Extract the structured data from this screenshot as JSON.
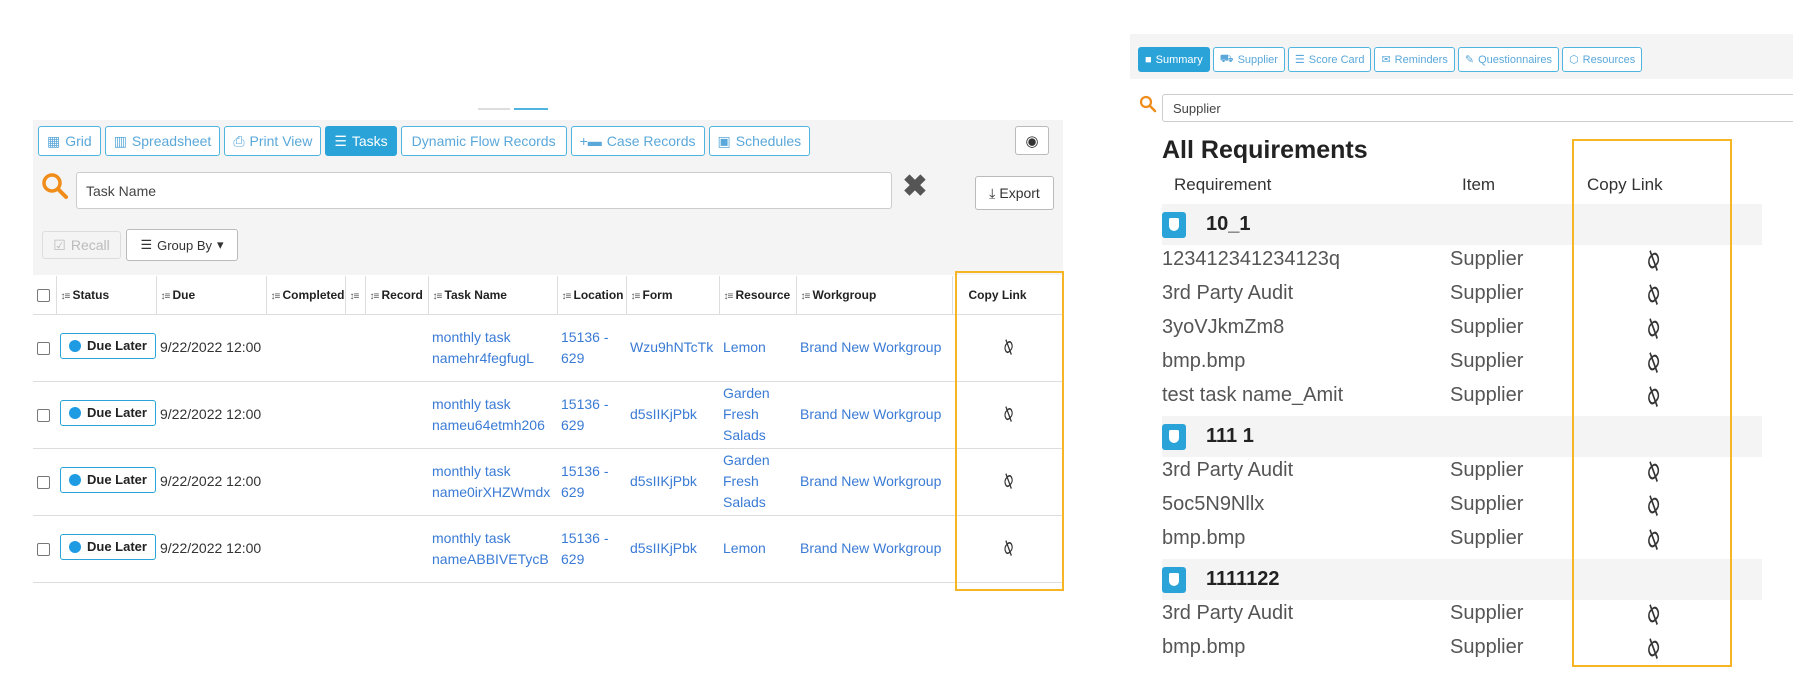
{
  "left": {
    "tabs": [
      {
        "icon": "grid-icon",
        "label": "Grid"
      },
      {
        "icon": "spreadsheet-icon",
        "label": "Spreadsheet"
      },
      {
        "icon": "print-icon",
        "label": "Print View"
      },
      {
        "icon": "tasks-icon",
        "label": "Tasks",
        "active": true
      },
      {
        "icon": "",
        "label": "Dynamic Flow Records"
      },
      {
        "icon": "briefcase-plus-icon",
        "label": "Case Records"
      },
      {
        "icon": "calendar-icon",
        "label": "Schedules"
      }
    ],
    "search": {
      "value": "Task Name"
    },
    "export_label": "Export",
    "recall_label": "Recall",
    "groupby_label": "Group By",
    "columns": [
      "Status",
      "Due",
      "Completed",
      "",
      "Record",
      "Task Name",
      "Location",
      "Form",
      "Resource",
      "Workgroup",
      "Copy Link"
    ],
    "rows": [
      {
        "status": "Due Later",
        "due": "9/22/2022 12:00",
        "task_name": "monthly task namehr4fegfugL",
        "location": "15136 - 629",
        "form": "Wzu9hNTcTk",
        "resource": "Lemon",
        "workgroup": "Brand New Workgroup"
      },
      {
        "status": "Due Later",
        "due": "9/22/2022 12:00",
        "task_name": "monthly task nameu64etmh206",
        "location": "15136 - 629",
        "form": "d5sIIKjPbk",
        "resource": "Garden Fresh Salads",
        "workgroup": "Brand New Workgroup"
      },
      {
        "status": "Due Later",
        "due": "9/22/2022 12:00",
        "task_name": "monthly task name0irXHZWmdx",
        "location": "15136 - 629",
        "form": "d5sIIKjPbk",
        "resource": "Garden Fresh Salads",
        "workgroup": "Brand New Workgroup"
      },
      {
        "status": "Due Later",
        "due": "9/22/2022 12:00",
        "task_name": "monthly task nameABBIVETycB",
        "location": "15136 - 629",
        "form": "d5sIIKjPbk",
        "resource": "Lemon",
        "workgroup": "Brand New Workgroup"
      }
    ]
  },
  "right": {
    "tabs": [
      {
        "icon": "summary-icon",
        "label": "Summary",
        "active": true
      },
      {
        "icon": "truck-icon",
        "label": "Supplier"
      },
      {
        "icon": "list-icon",
        "label": "Score Card"
      },
      {
        "icon": "envelope-icon",
        "label": "Reminders"
      },
      {
        "icon": "edit-icon",
        "label": "Questionnaires"
      },
      {
        "icon": "cube-icon",
        "label": "Resources"
      }
    ],
    "search": {
      "value": "Supplier"
    },
    "title": "All Requirements",
    "headers": {
      "requirement": "Requirement",
      "item": "Item",
      "copy_link": "Copy Link"
    },
    "groups": [
      {
        "label": "10_1",
        "rows": [
          {
            "requirement": "123412341234123q",
            "item": "Supplier"
          },
          {
            "requirement": "3rd Party Audit",
            "item": "Supplier"
          },
          {
            "requirement": "3yoVJkmZm8",
            "item": "Supplier"
          },
          {
            "requirement": "bmp.bmp",
            "item": "Supplier"
          },
          {
            "requirement": "test task name_Amit",
            "item": "Supplier"
          }
        ]
      },
      {
        "label": "111 1",
        "rows": [
          {
            "requirement": "3rd Party Audit",
            "item": "Supplier"
          },
          {
            "requirement": "5oc5N9Nllx",
            "item": "Supplier"
          },
          {
            "requirement": "bmp.bmp",
            "item": "Supplier"
          }
        ]
      },
      {
        "label": "1111122",
        "rows": [
          {
            "requirement": "3rd Party Audit",
            "item": "Supplier"
          },
          {
            "requirement": "bmp.bmp",
            "item": "Supplier"
          }
        ]
      }
    ]
  },
  "colors": {
    "accent": "#2aa3d9",
    "highlight": "#f6b525",
    "search_icon": "#f08c1a",
    "link": "#3a7bd5"
  }
}
